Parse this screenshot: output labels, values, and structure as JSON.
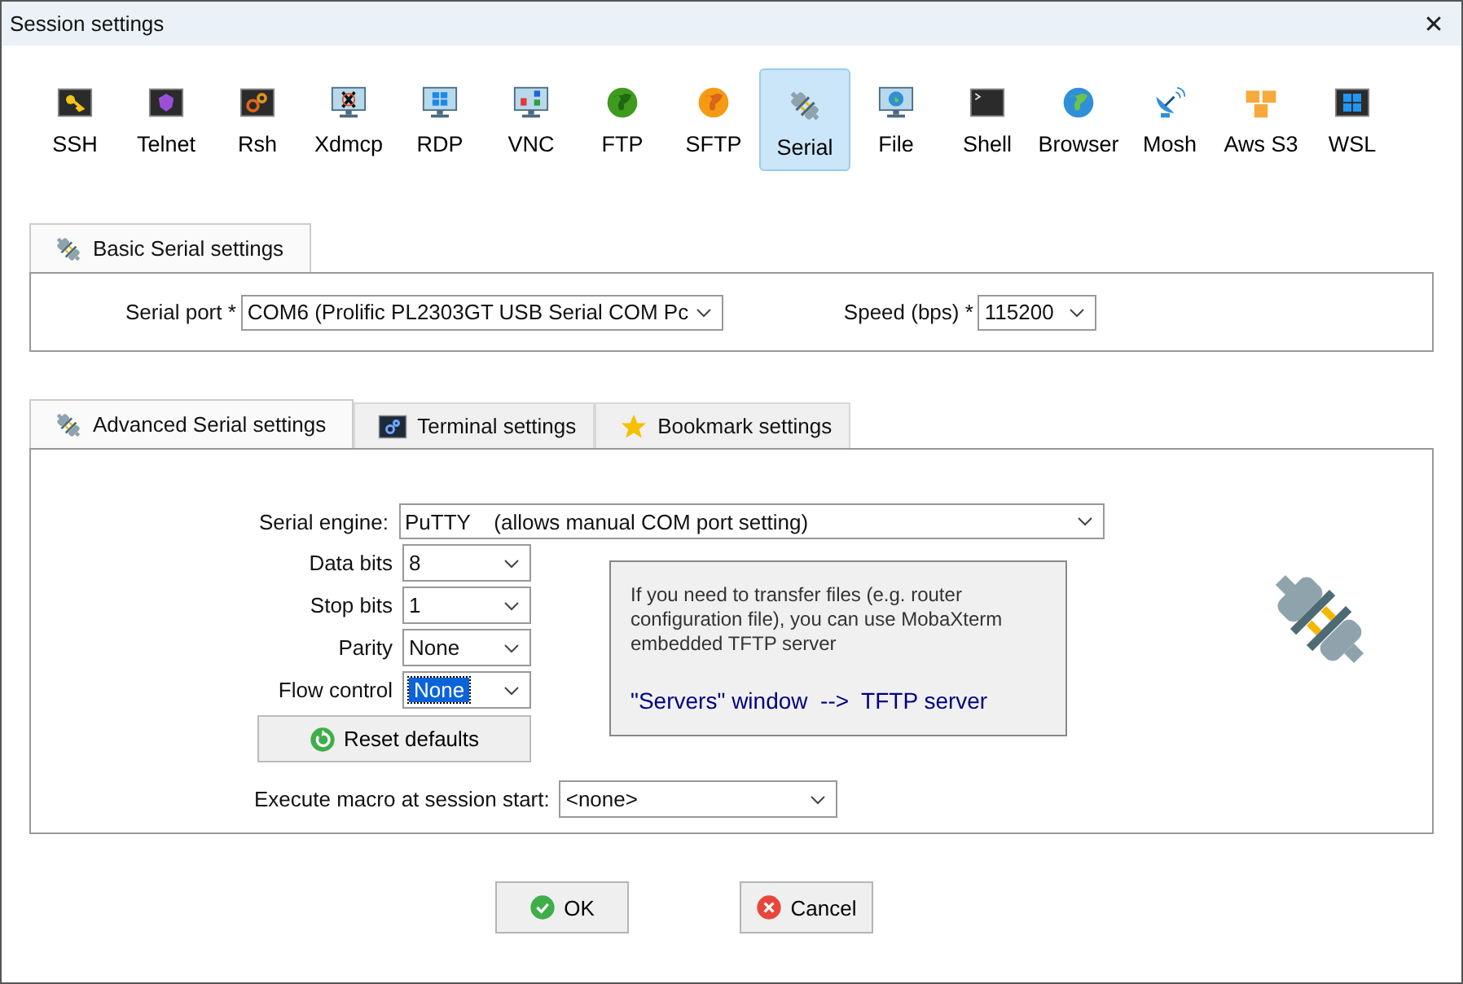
{
  "window": {
    "title": "Session settings",
    "close": "✕"
  },
  "session_types": [
    {
      "label": "SSH",
      "kind": "key",
      "selected": false
    },
    {
      "label": "Telnet",
      "kind": "gem",
      "selected": false
    },
    {
      "label": "Rsh",
      "kind": "gears",
      "selected": false
    },
    {
      "label": "Xdmcp",
      "kind": "x-monitor",
      "selected": false
    },
    {
      "label": "RDP",
      "kind": "win-monitor",
      "selected": false
    },
    {
      "label": "VNC",
      "kind": "vnc-monitor",
      "selected": false
    },
    {
      "label": "FTP",
      "kind": "green-globe",
      "selected": false
    },
    {
      "label": "SFTP",
      "kind": "orange-globe",
      "selected": false
    },
    {
      "label": "Serial",
      "kind": "plug",
      "selected": true
    },
    {
      "label": "File",
      "kind": "globe-monitor",
      "selected": false
    },
    {
      "label": "Shell",
      "kind": "terminal",
      "selected": false
    },
    {
      "label": "Browser",
      "kind": "blue-globe",
      "selected": false
    },
    {
      "label": "Mosh",
      "kind": "dish",
      "selected": false
    },
    {
      "label": "Aws S3",
      "kind": "cubes",
      "selected": false
    },
    {
      "label": "WSL",
      "kind": "win-tile",
      "selected": false
    }
  ],
  "basic_tab": {
    "label": "Basic Serial settings",
    "kind": "plug"
  },
  "basic": {
    "serial_port_label": "Serial port *",
    "serial_port": "COM6  (Prolific PL2303GT USB Serial COM Pc",
    "speed_label": "Speed (bps) *",
    "speed": "115200"
  },
  "advanced_tabs": [
    {
      "label": "Advanced Serial settings",
      "kind": "plug",
      "selected": true
    },
    {
      "label": "Terminal settings",
      "kind": "terminal-gears",
      "selected": false
    },
    {
      "label": "Bookmark settings",
      "kind": "star",
      "selected": false
    }
  ],
  "engine": {
    "label": "Serial engine:",
    "value": "PuTTY    (allows manual COM port setting)"
  },
  "fields": [
    {
      "label": "Data bits",
      "value": "8",
      "focused": false
    },
    {
      "label": "Stop bits",
      "value": "1",
      "focused": false
    },
    {
      "label": "Parity",
      "value": "None",
      "focused": false
    },
    {
      "label": "Flow control",
      "value": "None",
      "focused": true
    }
  ],
  "reset_button": "Reset defaults",
  "info": {
    "text": "If you need to transfer files (e.g. router configuration file), you can use MobaXterm embedded TFTP server",
    "hint": "\"Servers\" window  -->  TFTP server"
  },
  "macro": {
    "label": "Execute macro at session start:",
    "value": "<none>"
  },
  "buttons": [
    {
      "label": "OK",
      "kind": "ok"
    },
    {
      "label": "Cancel",
      "kind": "cancel"
    }
  ]
}
